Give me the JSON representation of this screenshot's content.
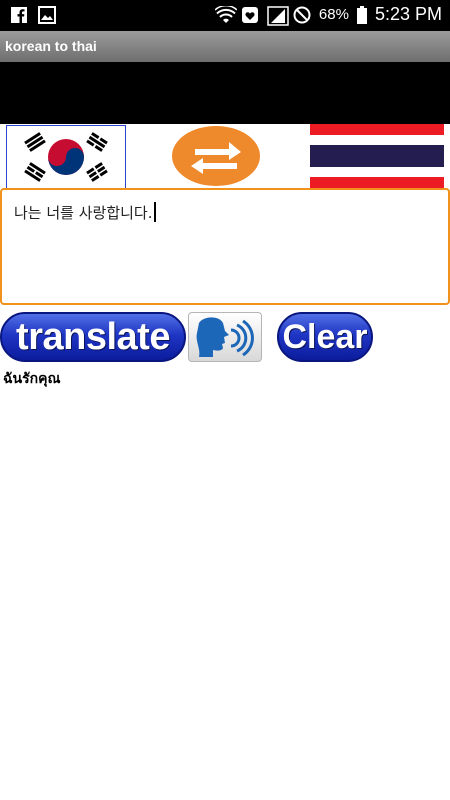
{
  "status_bar": {
    "battery_percent": "68%",
    "time": "5:23 PM",
    "icons": [
      "facebook-icon",
      "gallery-icon",
      "wifi-icon",
      "heart-icon",
      "signal-icon",
      "do-not-disturb-icon",
      "battery-icon"
    ]
  },
  "app": {
    "title": "korean to thai"
  },
  "languages": {
    "source": "korea-flag",
    "target": "thailand-flag"
  },
  "input": {
    "value": "나는 너를 사랑합니다."
  },
  "buttons": {
    "translate_label": "translate",
    "clear_label": "Clear"
  },
  "result": {
    "text": "ฉันรักคุณ"
  },
  "colors": {
    "input_border": "#f0921c",
    "button_blue": "#1f35c4",
    "swap_orange": "#ef8a2c"
  }
}
